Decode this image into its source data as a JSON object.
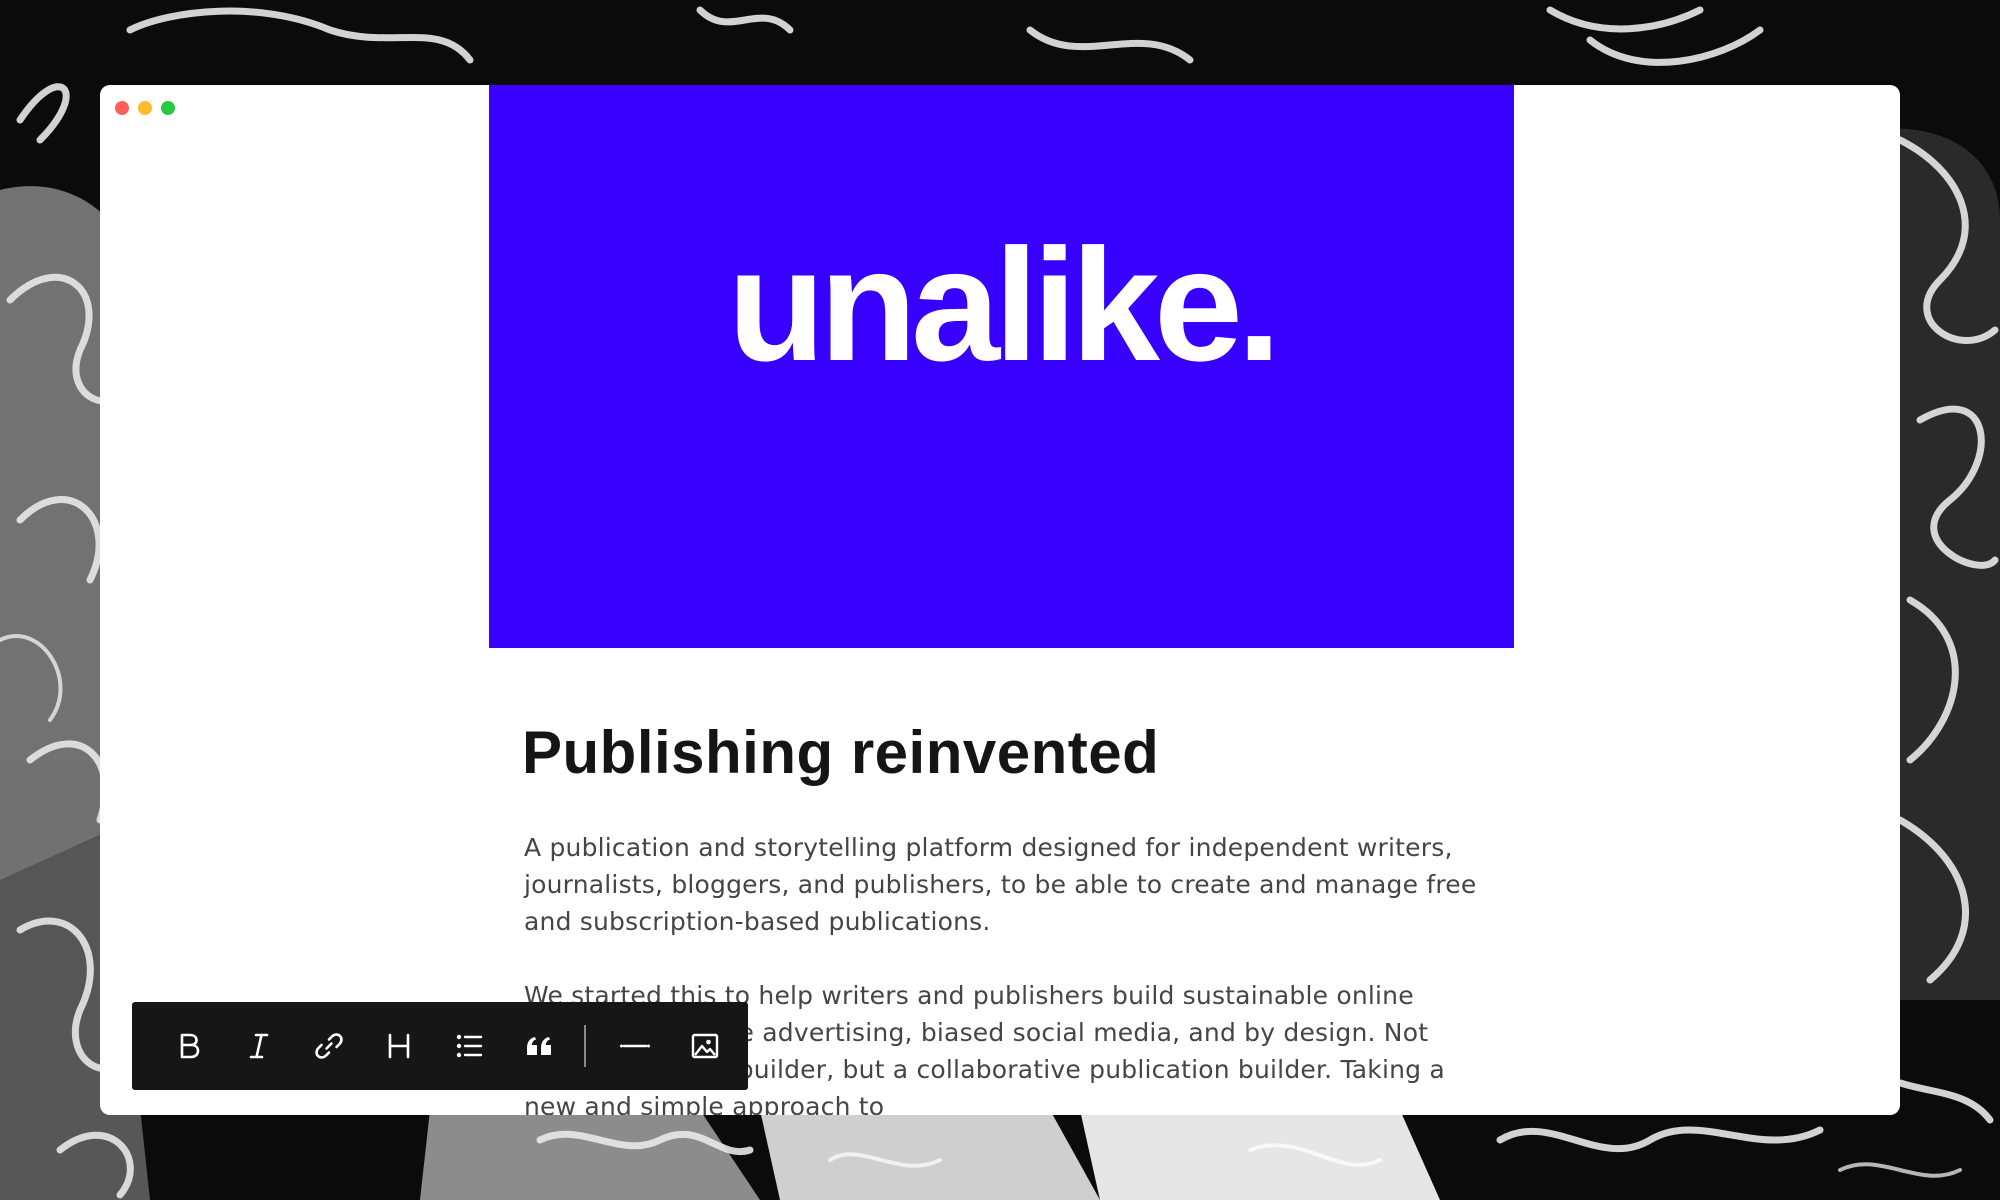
{
  "colors": {
    "hero_background": "#3700ff",
    "window_background": "#ffffff",
    "toolbar_background": "#161616",
    "title_text": "#151515",
    "body_text": "#454545"
  },
  "window": {
    "controls": [
      "close",
      "minimize",
      "maximize"
    ]
  },
  "hero": {
    "logo_text": "unalike."
  },
  "article": {
    "title": "Publishing reinvented",
    "paragraphs": [
      "A publication and storytelling platform designed for independent writers, journalists, bloggers, and publishers, to be able to create and manage free and subscription-based publications.",
      "We started this to help writers and publishers build sustainable online communities, free advertising, biased social media, and by design. Not another website builder, but a collaborative publication builder. Taking a new and simple approach to"
    ]
  },
  "toolbar": {
    "buttons": [
      {
        "icon": "bold-icon",
        "glyph": "B"
      },
      {
        "icon": "italic-icon",
        "glyph": "I"
      },
      {
        "icon": "link-icon"
      },
      {
        "icon": "heading-icon",
        "glyph": "H"
      },
      {
        "icon": "bullet-list-icon"
      },
      {
        "icon": "quote-icon"
      },
      {
        "icon": "divider-icon"
      },
      {
        "icon": "image-icon"
      }
    ]
  }
}
